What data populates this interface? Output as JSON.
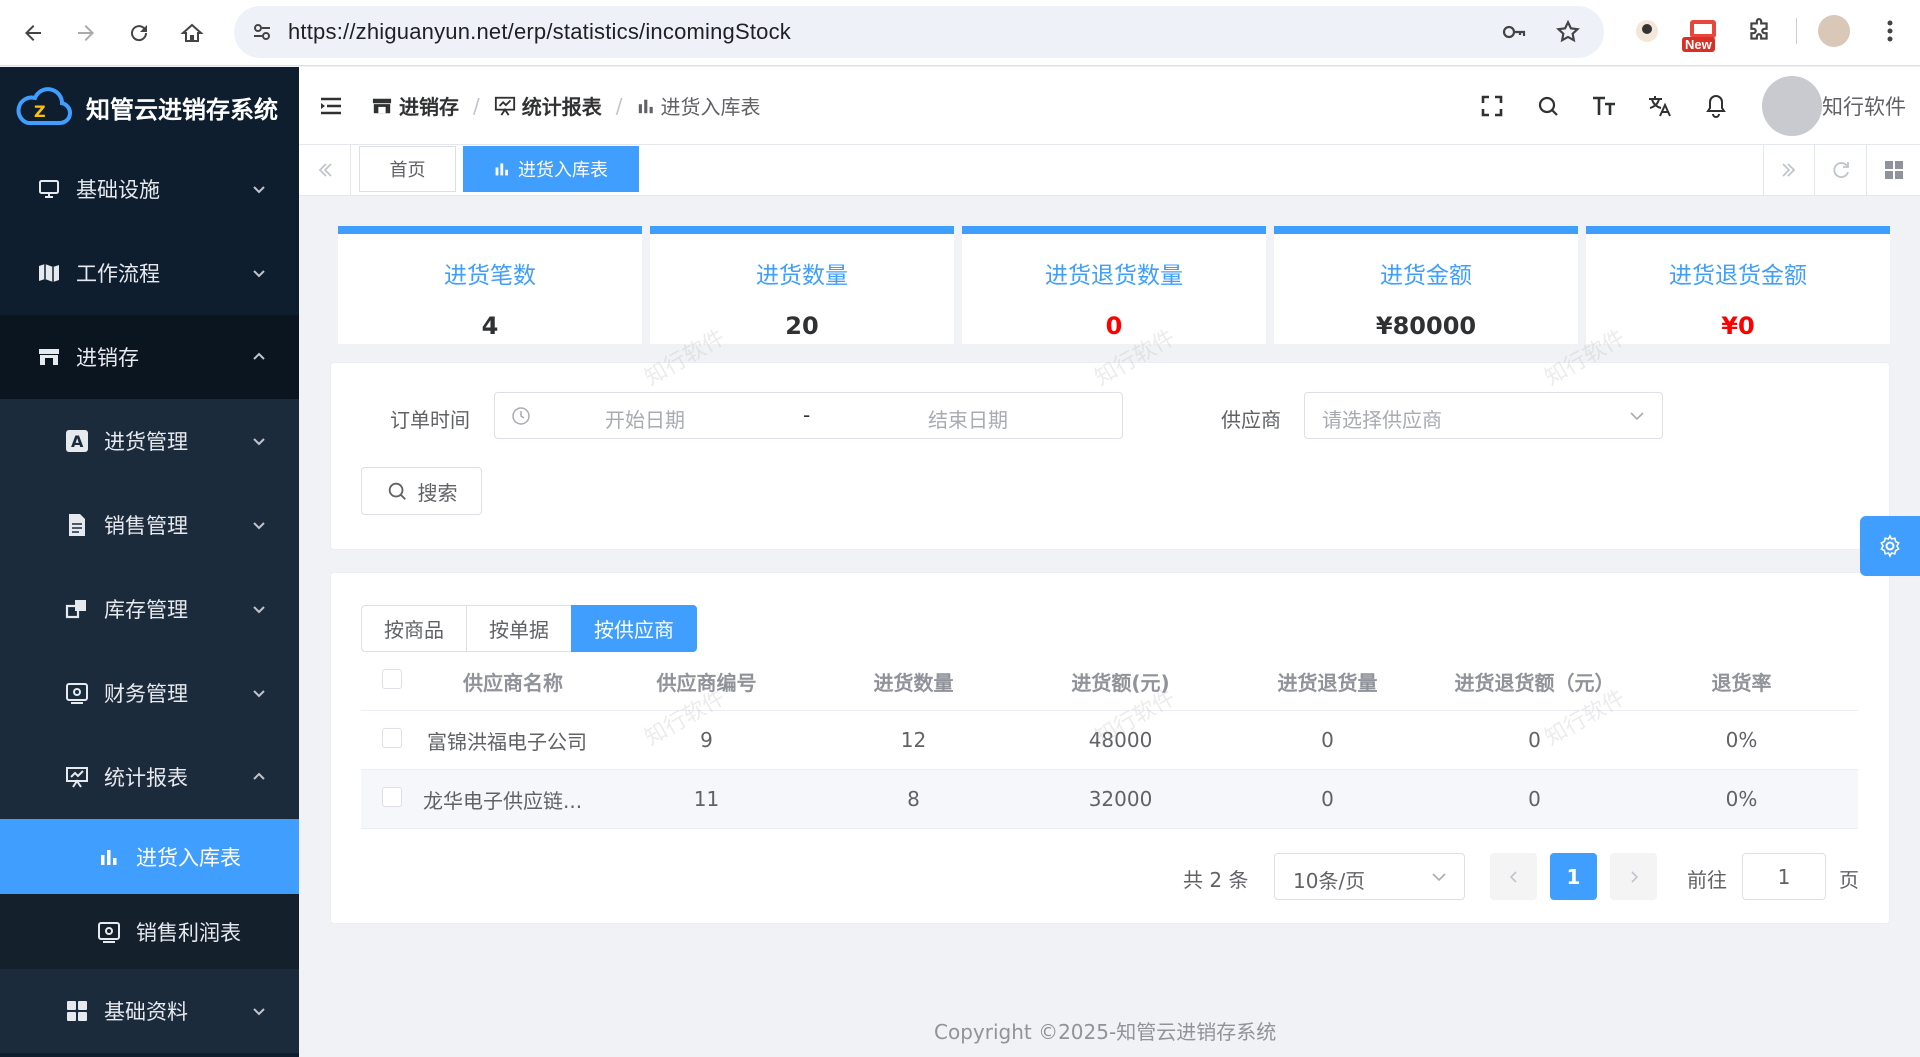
{
  "browser": {
    "url": "https://zhiguanyun.net/erp/statistics/incomingStock",
    "new_badge": "New"
  },
  "app": {
    "logo_text": "知管云进销存系统"
  },
  "sidebar": {
    "items": [
      {
        "label": "基础设施"
      },
      {
        "label": "工作流程"
      },
      {
        "label": "进销存"
      },
      {
        "label": "进货管理"
      },
      {
        "label": "销售管理"
      },
      {
        "label": "库存管理"
      },
      {
        "label": "财务管理"
      },
      {
        "label": "统计报表"
      },
      {
        "label": "进货入库表"
      },
      {
        "label": "销售利润表"
      },
      {
        "label": "基础资料"
      }
    ]
  },
  "header": {
    "breadcrumb": [
      "进销存",
      "统计报表",
      "进货入库表"
    ],
    "user_name": "知行软件"
  },
  "tabs": [
    "首页",
    "进货入库表"
  ],
  "stats": [
    {
      "label": "进货笔数",
      "value": "4",
      "color": "#303133"
    },
    {
      "label": "进货数量",
      "value": "20",
      "color": "#303133"
    },
    {
      "label": "进货退货数量",
      "value": "0",
      "color": "#ff0000"
    },
    {
      "label": "进货金额",
      "value": "¥80000",
      "color": "#303133"
    },
    {
      "label": "进货退货金额",
      "value": "¥0",
      "color": "#ff0000"
    }
  ],
  "search": {
    "order_time_label": "订单时间",
    "start_placeholder": "开始日期",
    "range_separator": "-",
    "end_placeholder": "结束日期",
    "supplier_label": "供应商",
    "supplier_placeholder": "请选择供应商",
    "search_button": "搜索"
  },
  "view_toggle": [
    "按商品",
    "按单据",
    "按供应商"
  ],
  "table": {
    "columns": [
      "供应商名称",
      "供应商编号",
      "进货数量",
      "进货额(元)",
      "进货退货量",
      "进货退货额（元）",
      "退货率"
    ],
    "rows": [
      [
        "富锦洪福电子公司",
        "9",
        "12",
        "48000",
        "0",
        "0",
        "0%"
      ],
      [
        "龙华电子供应链...",
        "11",
        "8",
        "32000",
        "0",
        "0",
        "0%"
      ]
    ]
  },
  "pagination": {
    "total_text": "共 2 条",
    "page_size": "10条/页",
    "current_page": "1",
    "goto_label": "前往",
    "goto_value": "1",
    "page_suffix": "页"
  },
  "footer": "Copyright ©2025-知管云进销存系统",
  "watermark": "知行软件",
  "colors": {
    "accent": "#409eff",
    "sidebar_bg": "#0f1e2e",
    "danger": "#ff0000"
  }
}
